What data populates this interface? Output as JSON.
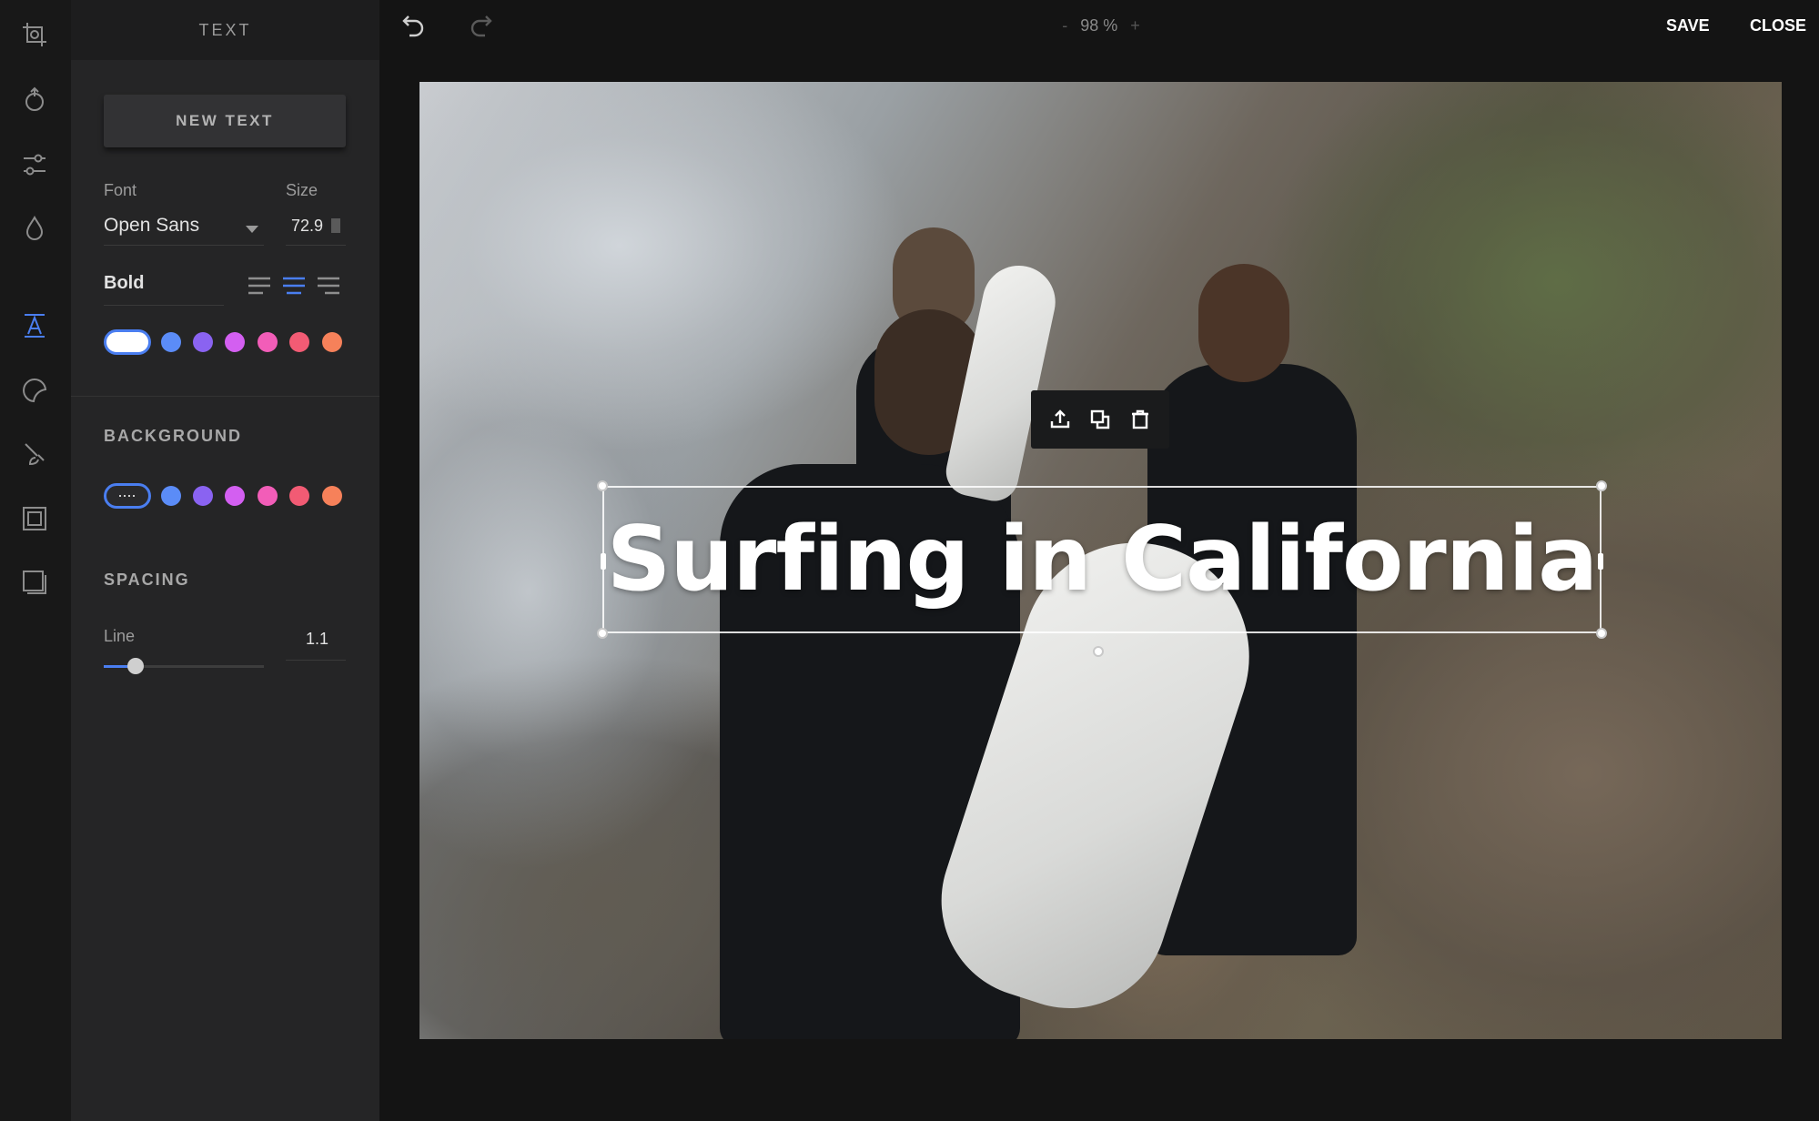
{
  "panel": {
    "title": "TEXT",
    "new_text_label": "NEW TEXT",
    "font_label": "Font",
    "font_value": "Open Sans",
    "size_label": "Size",
    "size_value": "72.9",
    "weight_value": "Bold",
    "text_colors": [
      "#ffffff",
      "#5b8cf7",
      "#8a63f1",
      "#d35ff1",
      "#f25db8",
      "#f25b74",
      "#f6815a"
    ],
    "background_title": "BACKGROUND",
    "background_colors": [
      "transparent",
      "#5b8cf7",
      "#8a63f1",
      "#d35ff1",
      "#f25db8",
      "#f25b74",
      "#f6815a"
    ],
    "spacing_title": "SPACING",
    "line_label": "Line",
    "line_value": "1.1",
    "line_slider_fraction": 0.2
  },
  "topbar": {
    "zoom_minus": "-",
    "zoom_value": "98 %",
    "zoom_plus": "+",
    "save_label": "SAVE",
    "close_label": "CLOSE"
  },
  "canvas": {
    "headline": "Surfing in California"
  },
  "colors": {
    "accent": "#4a7ef0"
  },
  "icons": {
    "rail": [
      "crop-icon",
      "orientation-icon",
      "adjust-icon",
      "filter-icon",
      "text-icon",
      "sticker-icon",
      "brush-icon",
      "frame-icon",
      "overlay-icon"
    ],
    "toolbar": [
      "bring-to-front-icon",
      "duplicate-icon",
      "delete-icon"
    ]
  }
}
